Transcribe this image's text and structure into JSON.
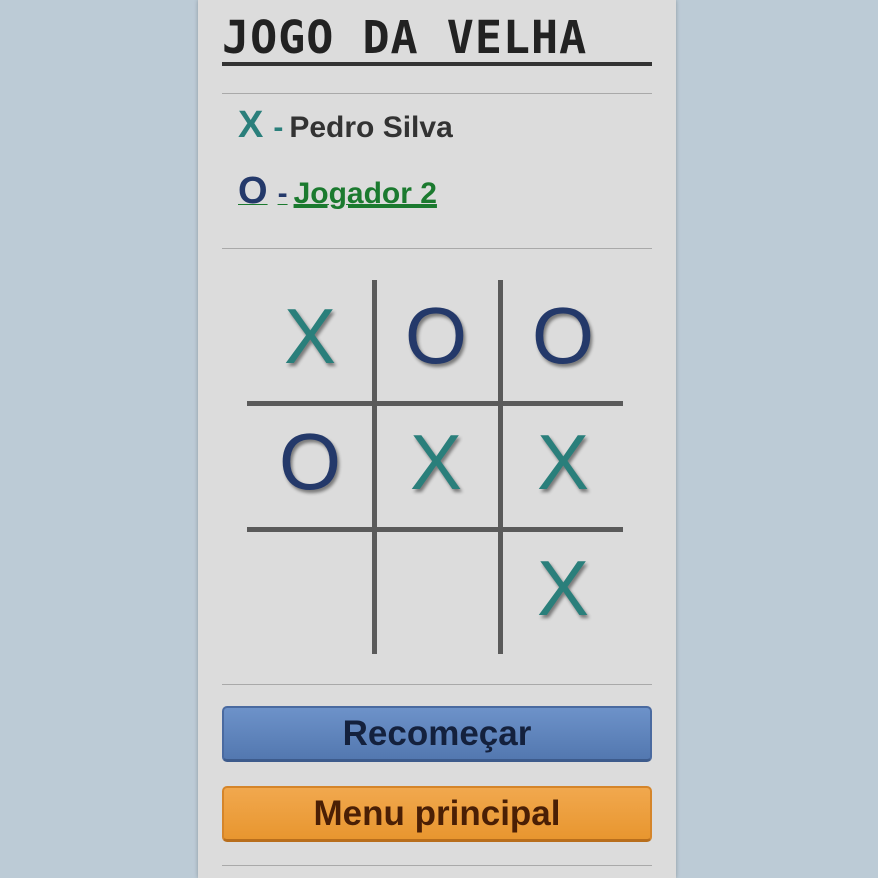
{
  "title": "JOGO DA VELHA",
  "players": {
    "x": {
      "symbol": "X",
      "dash": "-",
      "name": "Pedro Silva"
    },
    "o": {
      "symbol": "O",
      "dash": "-",
      "name": "Jogador 2"
    }
  },
  "board": [
    "X",
    "O",
    "O",
    "O",
    "X",
    "X",
    "",
    "",
    "X"
  ],
  "buttons": {
    "restart": "Recomeçar",
    "menu": "Menu principal"
  },
  "colors": {
    "x": "#2a7f7b",
    "o": "#24396a",
    "restart_button": "#5f84bd",
    "menu_button": "#ec9f3e",
    "background": "#bccbd6",
    "panel": "#dcdcdc"
  }
}
